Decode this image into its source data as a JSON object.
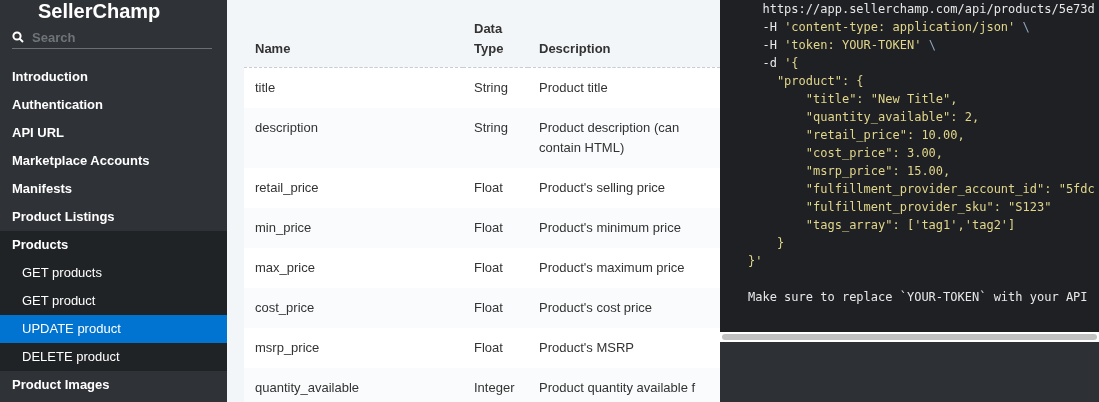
{
  "sidebar": {
    "logo": "SellerChamp",
    "search": {
      "placeholder": "Search"
    },
    "items": [
      {
        "label": "Introduction",
        "selected": false
      },
      {
        "label": "Authentication",
        "selected": false
      },
      {
        "label": "API URL",
        "selected": false
      },
      {
        "label": "Marketplace Accounts",
        "selected": false
      },
      {
        "label": "Manifests",
        "selected": false
      },
      {
        "label": "Product Listings",
        "selected": false
      },
      {
        "label": "Products",
        "selected": false,
        "expanded": true,
        "children": [
          {
            "label": "GET products",
            "selected": false
          },
          {
            "label": "GET product",
            "selected": false
          },
          {
            "label": "UPDATE product",
            "selected": true
          },
          {
            "label": "DELETE product",
            "selected": false
          }
        ]
      },
      {
        "label": "Product Images",
        "selected": false
      }
    ]
  },
  "table": {
    "columns": [
      "Name",
      "Data Type",
      "Description"
    ],
    "rows": [
      [
        "title",
        "String",
        "Product title"
      ],
      [
        "description",
        "String",
        "Product description (can contain HTML)"
      ],
      [
        "retail_price",
        "Float",
        "Product's selling price"
      ],
      [
        "min_price",
        "Float",
        "Product's minimum price"
      ],
      [
        "max_price",
        "Float",
        "Product's maximum price"
      ],
      [
        "cost_price",
        "Float",
        "Product's cost price"
      ],
      [
        "msrp_price",
        "Float",
        "Product's MSRP"
      ],
      [
        "quantity_available",
        "Integer",
        "Product quantity available f"
      ]
    ]
  },
  "code": {
    "lines": [
      [
        {
          "kind": "plain",
          "text": "  https://app.sellerchamp.com/api/products/5e73d"
        }
      ],
      [
        {
          "kind": "plain",
          "text": "  -H "
        },
        {
          "kind": "string",
          "text": "'content-type: application/json'"
        },
        {
          "kind": "escape",
          "text": " \\"
        }
      ],
      [
        {
          "kind": "plain",
          "text": "  -H "
        },
        {
          "kind": "string",
          "text": "'token: YOUR-TOKEN'"
        },
        {
          "kind": "escape",
          "text": " \\"
        }
      ],
      [
        {
          "kind": "plain",
          "text": "  -d "
        },
        {
          "kind": "string",
          "text": "'{"
        }
      ],
      [
        {
          "kind": "string",
          "text": "    \"product\": {"
        }
      ],
      [
        {
          "kind": "string",
          "text": "        \"title\": \"New Title\","
        }
      ],
      [
        {
          "kind": "string",
          "text": "        \"quantity_available\": 2,"
        }
      ],
      [
        {
          "kind": "string",
          "text": "        \"retail_price\": 10.00,"
        }
      ],
      [
        {
          "kind": "string",
          "text": "        \"cost_price\": 3.00,"
        }
      ],
      [
        {
          "kind": "string",
          "text": "        \"msrp_price\": 15.00,"
        }
      ],
      [
        {
          "kind": "string",
          "text": "        \"fulfillment_provider_account_id\": \"5fdc"
        }
      ],
      [
        {
          "kind": "string",
          "text": "        \"fulfillment_provider_sku\": \"S123\""
        }
      ],
      [
        {
          "kind": "string",
          "text": "        \"tags_array\": ['tag1','tag2']"
        }
      ],
      [
        {
          "kind": "string",
          "text": "    }"
        }
      ],
      [
        {
          "kind": "string",
          "text": "}'"
        }
      ]
    ],
    "note": "Make sure to replace `YOUR-TOKEN` with your API"
  }
}
